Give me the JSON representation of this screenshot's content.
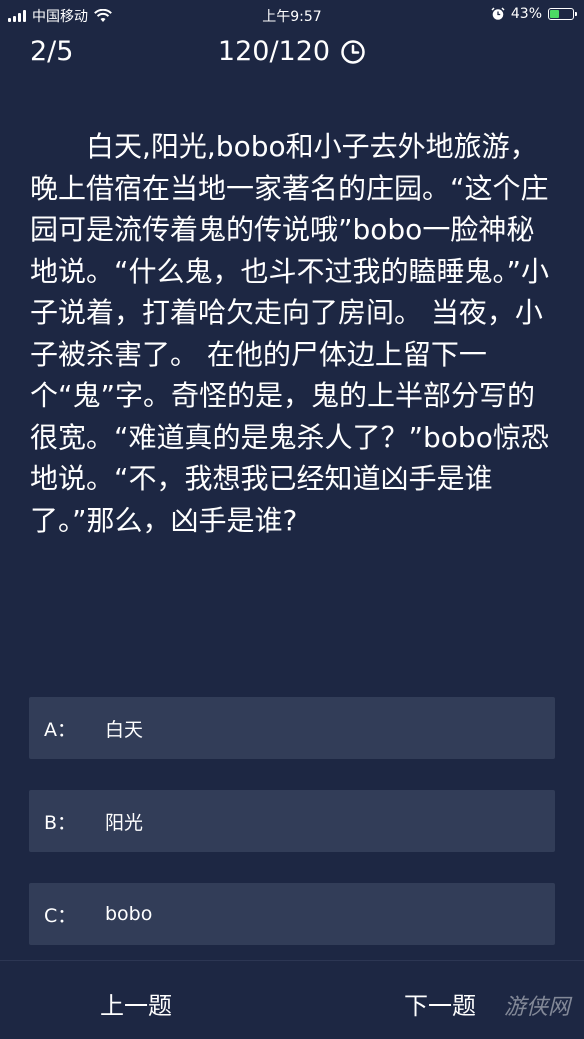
{
  "status_bar": {
    "carrier": "中国移动",
    "time": "上午9:57",
    "battery": "43%",
    "battery_level": 0.43,
    "icons": [
      "signal-icon",
      "wifi-icon",
      "alarm-icon",
      "battery-icon"
    ]
  },
  "header": {
    "progress": "2/5",
    "timer": "120/120",
    "timer_icon": "clock-icon"
  },
  "question": {
    "text": "白天,阳光,bobo和小子去外地旅游，晚上借宿在当地一家著名的庄园。“这个庄园可是流传着鬼的传说哦”bobo一脸神秘地说。“什么鬼，也斗不过我的瞌睡鬼。”小子说着，打着哈欠走向了房间。 当夜，小子被杀害了。 在他的尸体边上留下一个“鬼”字。奇怪的是，鬼的上半部分写的很宽。“难道真的是鬼杀人了？”bobo惊恐地说。“不，我想我已经知道凶手是谁了。”那么，凶手是谁?"
  },
  "options": [
    {
      "letter": "A：",
      "text": "白天"
    },
    {
      "letter": "B：",
      "text": "阳光"
    },
    {
      "letter": "C：",
      "text": "bobo"
    }
  ],
  "footer": {
    "prev_label": "上一题",
    "next_label": "下一题",
    "watermark": "游侠网"
  },
  "colors": {
    "background": "#1d2743",
    "option_background": "#323d58",
    "battery_fill": "#4cd964"
  }
}
